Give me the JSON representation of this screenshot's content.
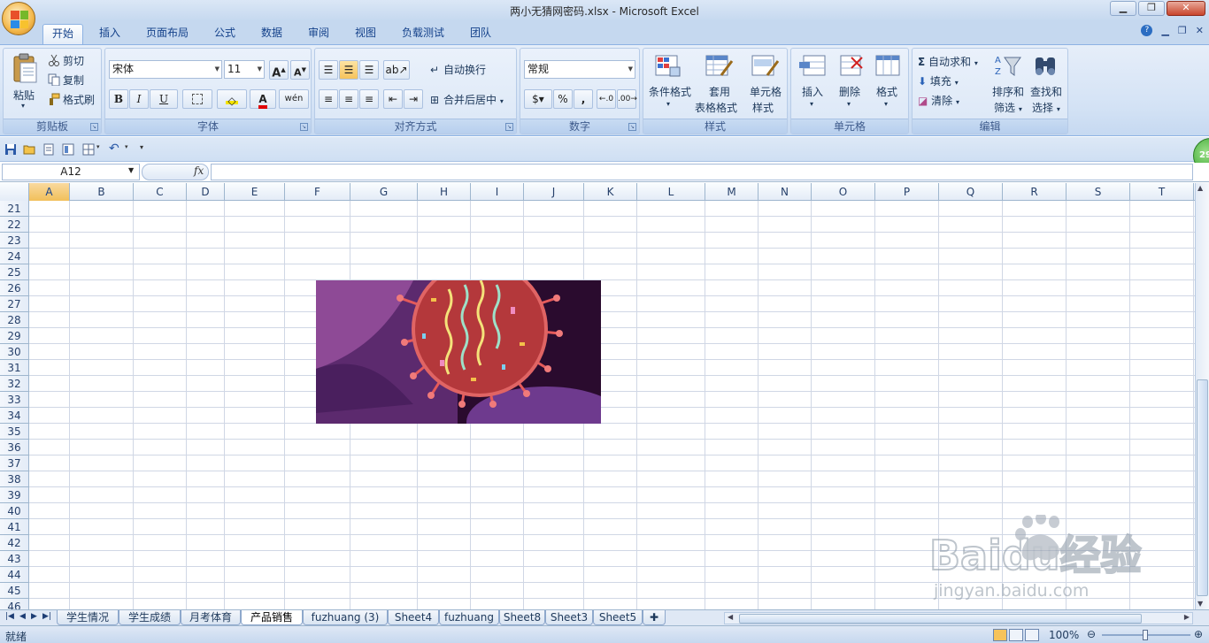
{
  "window": {
    "title": "两小无猜网密码.xlsx - Microsoft Excel",
    "controls": [
      "minimize",
      "restore",
      "close"
    ]
  },
  "ribbon_tabs": [
    "开始",
    "插入",
    "页面布局",
    "公式",
    "数据",
    "审阅",
    "视图",
    "负载测试",
    "团队"
  ],
  "active_tab": "开始",
  "ribbon": {
    "clipboard": {
      "label": "剪贴板",
      "paste": "粘贴",
      "cut": "剪切",
      "copy": "复制",
      "format_painter": "格式刷"
    },
    "font": {
      "label": "字体",
      "font_name": "宋体",
      "font_size": "11",
      "bold": "B",
      "italic": "I",
      "underline": "U"
    },
    "alignment": {
      "label": "对齐方式",
      "wrap_text": "自动换行",
      "merge_center": "合并后居中"
    },
    "number": {
      "label": "数字",
      "format": "常规",
      "percent": "%",
      "comma": ","
    },
    "styles": {
      "label": "样式",
      "conditional": "条件格式",
      "table_format_1": "套用",
      "table_format_2": "表格格式",
      "cell_styles_1": "单元格",
      "cell_styles_2": "样式"
    },
    "cells": {
      "label": "单元格",
      "insert": "插入",
      "delete": "删除",
      "format": "格式"
    },
    "editing": {
      "label": "编辑",
      "autosum": "自动求和",
      "fill": "填充",
      "clear": "清除",
      "sort_1": "排序和",
      "sort_2": "筛选",
      "find_1": "查找和",
      "find_2": "选择"
    }
  },
  "formula_bar": {
    "name_box": "A12",
    "fx": "fx",
    "formula": ""
  },
  "badge": "29",
  "columns": [
    "A",
    "B",
    "C",
    "D",
    "E",
    "F",
    "G",
    "H",
    "I",
    "J",
    "K",
    "L",
    "M",
    "N",
    "O",
    "P",
    "Q",
    "R",
    "S",
    "T"
  ],
  "selected_column": "A",
  "rows": [
    "21",
    "22",
    "23",
    "24",
    "25",
    "26",
    "27",
    "28",
    "29",
    "30",
    "31",
    "32",
    "33",
    "34",
    "35",
    "36",
    "37",
    "38",
    "39",
    "40",
    "41",
    "42",
    "43",
    "44",
    "45",
    "46"
  ],
  "sheet_tabs": [
    "学生情况",
    "学生成绩",
    "月考体育",
    "产品销售",
    "fuzhuang (3)",
    "Sheet4",
    "fuzhuang",
    "Sheet8",
    "Sheet3",
    "Sheet5"
  ],
  "active_sheet": "产品销售",
  "status": {
    "ready": "就绪",
    "zoom": "100%"
  },
  "watermark": {
    "brand": "Baidu经验",
    "url": "jingyan.baidu.com"
  },
  "colors": {
    "ribbon_text": "#15428b",
    "selected_header": "#f1c05a",
    "grid_line": "#d0d7e5",
    "picture_bg": "#8b3f8f",
    "virus_red": "#b4383b"
  }
}
